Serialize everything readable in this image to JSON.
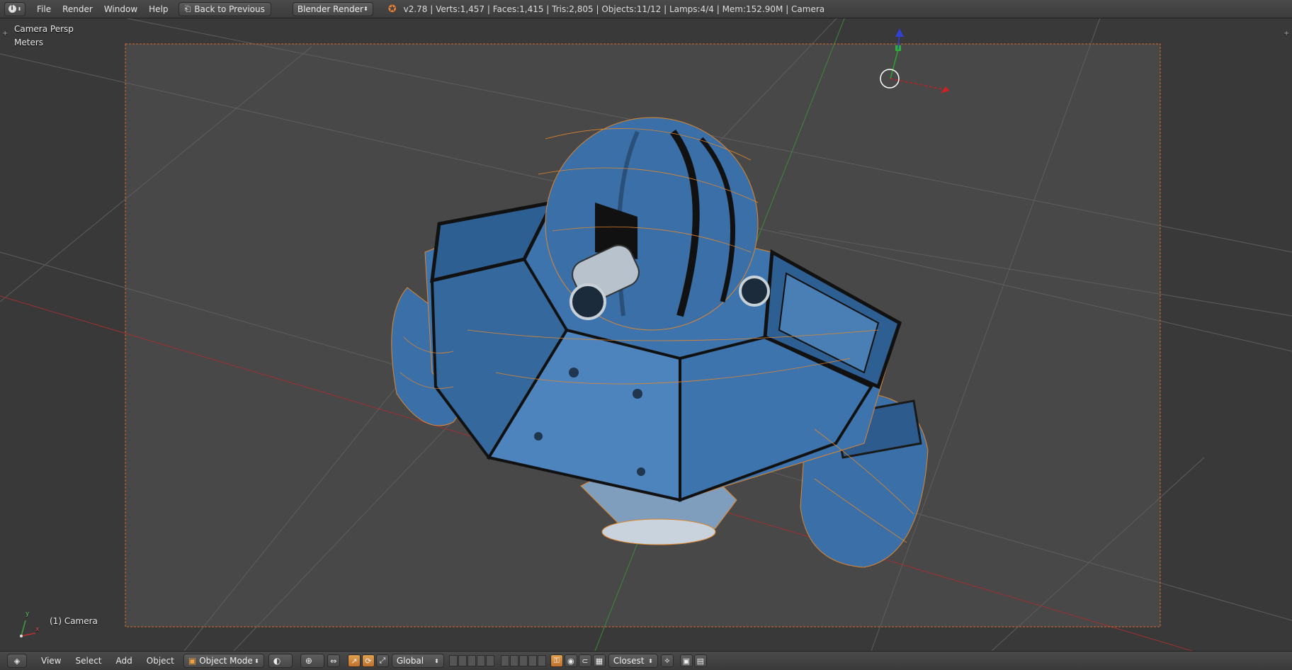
{
  "topbar": {
    "menus": [
      "File",
      "Render",
      "Window",
      "Help"
    ],
    "back_button": "Back to Previous",
    "render_engine": "Blender Render",
    "stats": "v2.78 | Verts:1,457 | Faces:1,415 | Tris:2,805 | Objects:11/12 | Lamps:4/4 | Mem:152.90M | Camera"
  },
  "viewport": {
    "view_name": "Camera Persp",
    "units": "Meters",
    "object_label": "(1) Camera",
    "axis_labels": {
      "x": "x",
      "y": "y"
    }
  },
  "bottombar": {
    "menus": [
      "View",
      "Select",
      "Add",
      "Object"
    ],
    "mode": "Object Mode",
    "orientation": "Global",
    "snap_target": "Closest"
  },
  "colors": {
    "mesh_blue": "#3a6fa8",
    "wire": "#e0862d",
    "grid": "#5a5a5a",
    "x_axis": "#c03030",
    "y_axis": "#40a040",
    "z_axis": "#3050d0"
  }
}
